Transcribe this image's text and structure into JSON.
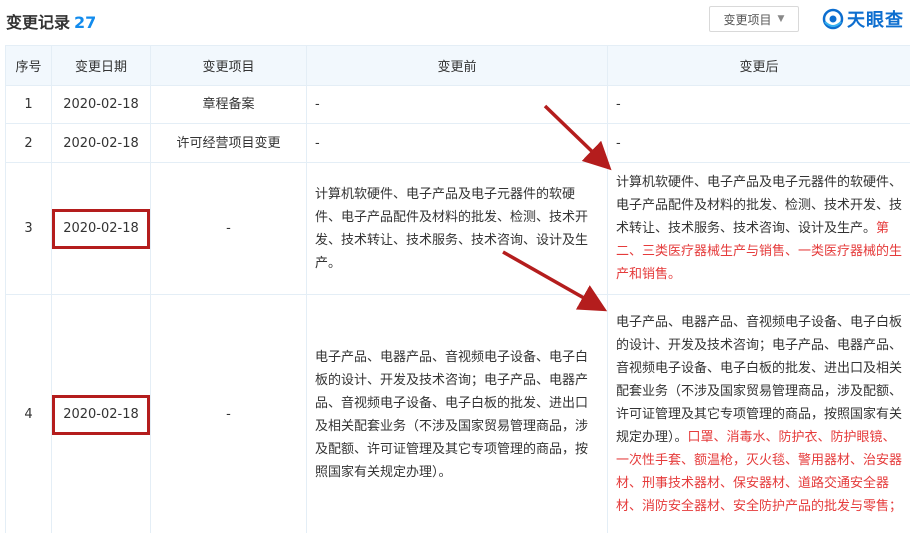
{
  "header": {
    "title": "变更记录",
    "count": "27",
    "filter_label": "变更项目",
    "logo_text": "天眼查"
  },
  "table": {
    "columns": [
      "序号",
      "变更日期",
      "变更项目",
      "变更前",
      "变更后"
    ],
    "rows": [
      {
        "index": "1",
        "date": "2020-02-18",
        "item": "章程备案",
        "before": "-",
        "after": "-",
        "after_added": ""
      },
      {
        "index": "2",
        "date": "2020-02-18",
        "item": "许可经营项目变更",
        "before": "-",
        "after": "-",
        "after_added": ""
      },
      {
        "index": "3",
        "date": "2020-02-18",
        "item": "-",
        "before": "计算机软硬件、电子产品及电子元器件的软硬件、电子产品配件及材料的批发、检测、技术开发、技术转让、技术服务、技术咨询、设计及生产。",
        "after": "计算机软硬件、电子产品及电子元器件的软硬件、电子产品配件及材料的批发、检测、技术开发、技术转让、技术服务、技术咨询、设计及生产。",
        "after_added": "第二、三类医疗器械生产与销售、一类医疗器械的生产和销售。"
      },
      {
        "index": "4",
        "date": "2020-02-18",
        "item": "-",
        "before": "电子产品、电器产品、音视频电子设备、电子白板的设计、开发及技术咨询；电子产品、电器产品、音视频电子设备、电子白板的批发、进出口及相关配套业务（不涉及国家贸易管理商品，涉及配额、许可证管理及其它专项管理的商品，按照国家有关规定办理）。",
        "after": "电子产品、电器产品、音视频电子设备、电子白板的设计、开发及技术咨询；电子产品、电器产品、音视频电子设备、电子白板的批发、进出口及相关配套业务（不涉及国家贸易管理商品，涉及配额、许可证管理及其它专项管理的商品，按照国家有关规定办理）。",
        "after_added": "口罩、消毒水、防护衣、防护眼镜、一次性手套、额温枪，灭火毯、警用器材、治安器材、刑事技术器材、保安器材、道路交通安全器材、消防安全器材、安全防护产品的批发与零售；"
      }
    ]
  },
  "colors": {
    "accent": "#128bed",
    "header_bg": "#f2f8fd",
    "highlight_text": "#e53b3b",
    "annotation": "#b41d1d"
  }
}
